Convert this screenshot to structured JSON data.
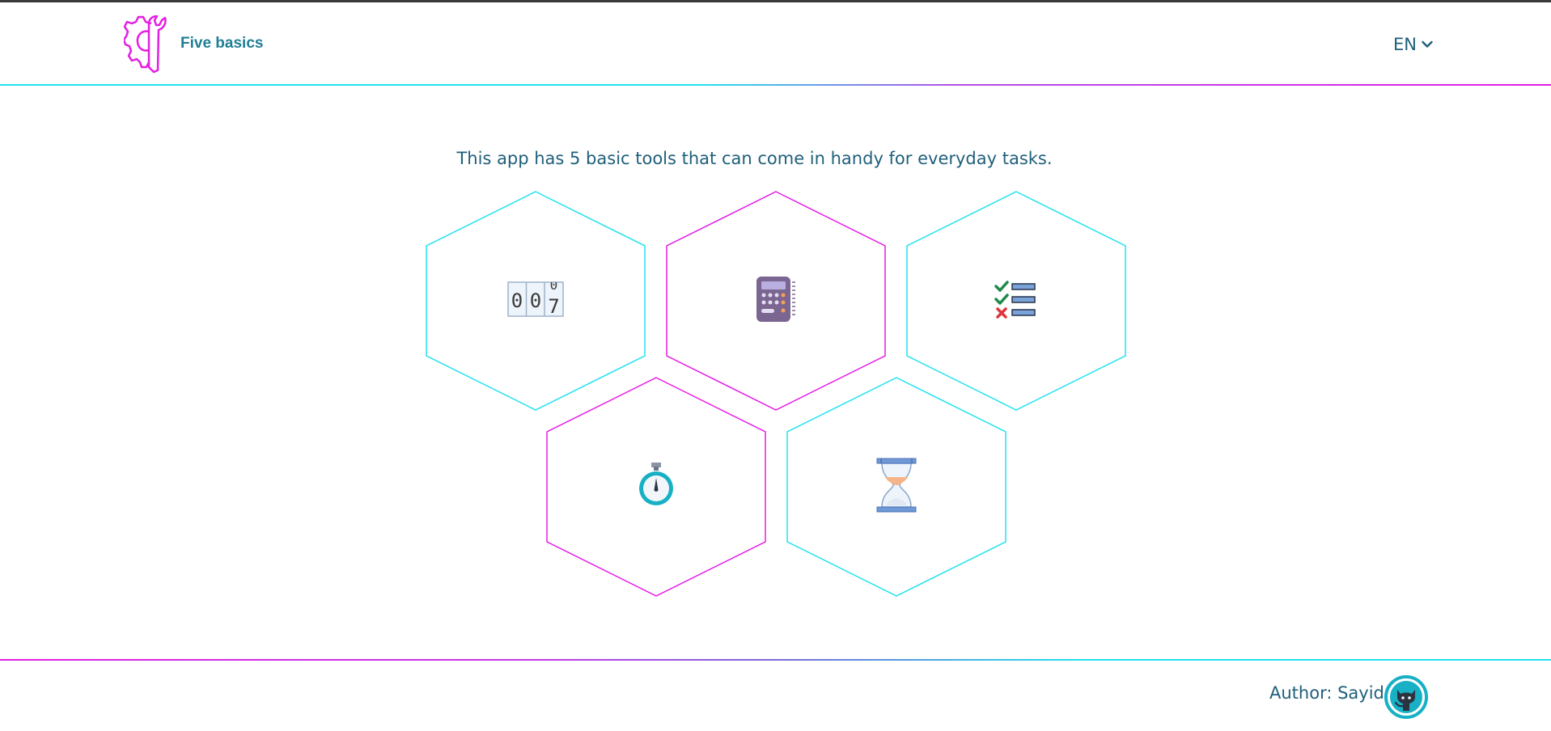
{
  "header": {
    "app_name": "Five basics",
    "language": "EN"
  },
  "main": {
    "intro": "This app has 5 basic tools that can come in handy for everyday tasks.",
    "tools": [
      {
        "icon": "counter-icon",
        "counter_digits": [
          "0",
          "0",
          "7"
        ]
      },
      {
        "icon": "calculator-icon"
      },
      {
        "icon": "checklist-icon"
      },
      {
        "icon": "stopwatch-icon"
      },
      {
        "icon": "hourglass-icon"
      }
    ]
  },
  "footer": {
    "author": "Author: Sayid",
    "link_icon": "github-icon"
  },
  "colors": {
    "cyan": "#22e2f0",
    "magenta": "#e31ee3",
    "text": "#1f5f7a",
    "brand_text": "#1f7f94"
  }
}
